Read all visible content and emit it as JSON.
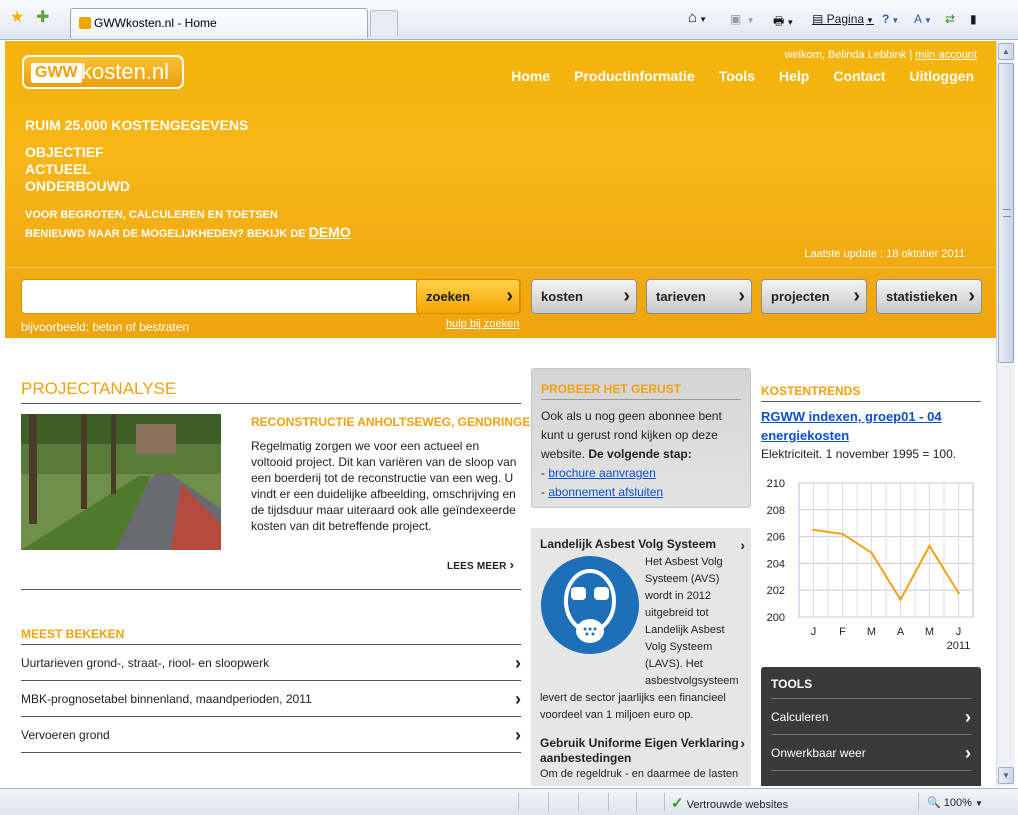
{
  "browser": {
    "tab_title": "GWWkosten.nl - Home",
    "page_menu": "Pagina",
    "status_zone": "Vertrouwde websites",
    "zoom": "100%"
  },
  "header": {
    "logo_gww": "GWW",
    "logo_rest": "kosten.nl",
    "welcome": "welkom, Belinda Lebbink |",
    "my_account": "mijn account",
    "nav": [
      "Home",
      "Productinformatie",
      "Tools",
      "Help",
      "Contact",
      "Uitloggen"
    ]
  },
  "hero": {
    "headline": "RUIM 25.000 KOSTENGEGEVENS",
    "words": [
      "OBJECTIEF",
      "ACTUEEL",
      "ONDERBOUWD"
    ],
    "line1": "VOOR BEGROTEN, CALCULEREN EN TOETSEN",
    "line2": "BENIEUWD NAAR DE MOGELIJKHEDEN? BEKIJK DE",
    "demo": "DEMO",
    "update": "Laatste update : 18 oktober 2011"
  },
  "search": {
    "button": "zoeken",
    "example": "bijvoorbeeld: beton of bestraten",
    "help": "hulp bij zoeken",
    "categories": [
      "kosten",
      "tarieven",
      "projecten",
      "statistieken"
    ]
  },
  "project": {
    "section_title": "PROJECTANALYSE",
    "title": "RECONSTRUCTIE ANHOLTSEWEG, GENDRINGEN",
    "body": "Regelmatig zorgen we voor een actueel en voltooid project. Dit kan variëren van de sloop van een boerderij tot de reconstructie van een weg. U vindt er een duidelijke afbeelding, omschrijving en de tijdsduur maar uiteraard ook alle geïndexeerde kosten van dit betreffende project.",
    "read_more": "LEES MEER"
  },
  "most_viewed": {
    "title": "MEEST BEKEKEN",
    "items": [
      "Uurtarieven grond-, straat-, riool- en sloopwerk",
      "MBK-prognosetabel binnenland, maandperioden, 2011",
      "Vervoeren grond"
    ]
  },
  "trial": {
    "title": "PROBEER HET GERUST",
    "text": "Ook als u nog geen abonnee bent kunt u gerust rond kijken op deze website.",
    "next_step": "De volgende stap:",
    "links": [
      "brochure aanvragen",
      "abonnement afsluiten"
    ]
  },
  "news": {
    "item1_title": "Landelijk Asbest Volg Systeem",
    "item1_body": "Het Asbest Volg Systeem (AVS) wordt in 2012 uitgebreid tot Landelijk Asbest Volg Systeem (LAVS). Het asbestvolgsysteem levert de sector jaarlijks een financieel voordeel van 1 miljoen euro op.",
    "item2_title": "Gebruik Uniforme Eigen Verklaring aanbestedingen",
    "item2_body": "Om de regeldruk - en daarmee de lasten"
  },
  "trends": {
    "title": "KOSTENTRENDS",
    "link": "RGWW indexen, groep01 - 04 energiekosten",
    "caption": "Elektriciteit. 1 november 1995 = 100."
  },
  "chart_data": {
    "type": "line",
    "categories": [
      "J",
      "F",
      "M",
      "A",
      "M",
      "J"
    ],
    "values": [
      206.5,
      206.2,
      204.8,
      201.3,
      205.3,
      201.8
    ],
    "xlabel": "2011",
    "ylim": [
      200,
      210
    ],
    "yticks": [
      210,
      208,
      206,
      204,
      202,
      200
    ],
    "grid": true,
    "line_color": "#f3a20d"
  },
  "tools": {
    "title": "TOOLS",
    "items": [
      "Calculeren",
      "Onwerkbaar weer"
    ]
  }
}
